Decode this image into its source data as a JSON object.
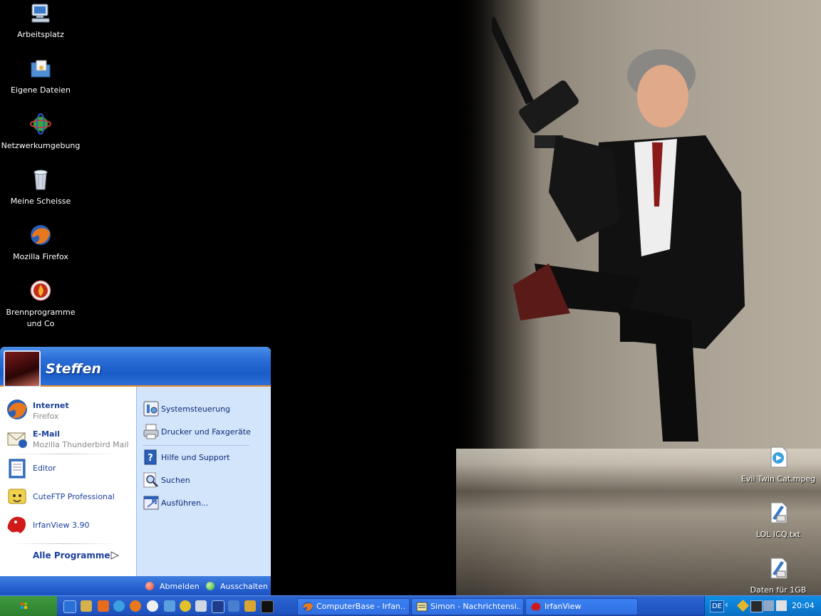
{
  "desktop": {
    "icons": [
      {
        "label": "Arbeitsplatz",
        "icon": "my-computer-icon"
      },
      {
        "label": "Eigene Dateien",
        "icon": "my-documents-icon"
      },
      {
        "label": "Netzwerkumgebung",
        "icon": "network-icon"
      },
      {
        "label": "Meine Scheisse",
        "icon": "recycle-bin-icon"
      },
      {
        "label": "Mozilla Firefox",
        "icon": "firefox-icon"
      },
      {
        "label": "Brennprogramme und Co",
        "icon": "burn-icon"
      }
    ],
    "right_icons": [
      {
        "label": "Evil Twin Cat.mpeg",
        "icon": "media-file-icon"
      },
      {
        "label": "LOL ICQ.txt",
        "icon": "text-file-icon"
      },
      {
        "label": "Daten für 1GB",
        "icon": "text-file-icon"
      }
    ]
  },
  "start_menu": {
    "user_name": "Steffen",
    "pinned": [
      {
        "title": "Internet",
        "subtitle": "Firefox",
        "icon": "firefox-icon"
      },
      {
        "title": "E-Mail",
        "subtitle": "Mozilla Thunderbird Mail",
        "icon": "mail-icon"
      }
    ],
    "recent": [
      {
        "title": "Editor",
        "icon": "notepad-icon"
      },
      {
        "title": "CuteFTP Professional",
        "icon": "ftp-icon"
      },
      {
        "title": "IrfanView 3.90",
        "icon": "irfanview-icon"
      }
    ],
    "all_programs": "Alle Programme",
    "right": [
      {
        "title": "Systemsteuerung",
        "icon": "control-panel-icon"
      },
      {
        "title": "Drucker und Faxgeräte",
        "icon": "printer-icon"
      },
      {
        "title": "Hilfe und Support",
        "icon": "help-icon"
      },
      {
        "title": "Suchen",
        "icon": "search-icon"
      },
      {
        "title": "Ausführen...",
        "icon": "run-icon"
      }
    ],
    "logoff": "Abmelden",
    "shutdown": "Ausschalten"
  },
  "taskbar": {
    "tasks": [
      {
        "label": "ComputerBase - Irfan...",
        "icon": "firefox-icon"
      },
      {
        "label": "Simon - Nachrichtensi...",
        "icon": "message-icon"
      },
      {
        "label": "IrfanView",
        "icon": "irfanview-icon"
      }
    ],
    "language": "DE",
    "clock": "20:04"
  }
}
